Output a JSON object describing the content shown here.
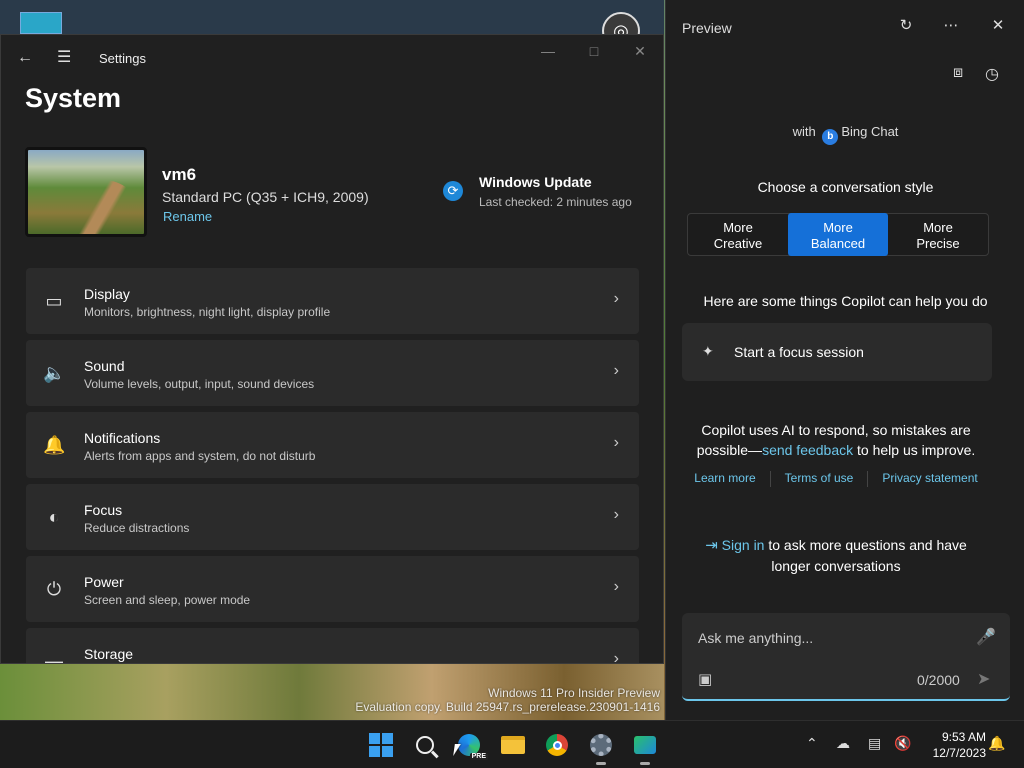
{
  "settings": {
    "window_title": "Settings",
    "page_title": "System",
    "device": {
      "name": "vm6",
      "model": "Standard PC (Q35 + ICH9, 2009)",
      "rename_label": "Rename"
    },
    "windows_update": {
      "title": "Windows Update",
      "status": "Last checked: 2 minutes ago"
    },
    "items": [
      {
        "title": "Display",
        "subtitle": "Monitors, brightness, night light, display profile",
        "icon": "monitor-icon"
      },
      {
        "title": "Sound",
        "subtitle": "Volume levels, output, input, sound devices",
        "icon": "speaker-icon"
      },
      {
        "title": "Notifications",
        "subtitle": "Alerts from apps and system, do not disturb",
        "icon": "bell-icon"
      },
      {
        "title": "Focus",
        "subtitle": "Reduce distractions",
        "icon": "focus-icon"
      },
      {
        "title": "Power",
        "subtitle": "Screen and sleep, power mode",
        "icon": "power-icon"
      },
      {
        "title": "Storage",
        "subtitle": "",
        "icon": "storage-icon"
      }
    ]
  },
  "copilot": {
    "title": "Preview",
    "with_prefix": "with",
    "with_brand": "Bing Chat",
    "style_label": "Choose a conversation style",
    "styles": [
      {
        "line1": "More",
        "line2": "Creative"
      },
      {
        "line1": "More",
        "line2": "Balanced"
      },
      {
        "line1": "More",
        "line2": "Precise"
      }
    ],
    "active_style_index": 1,
    "help_heading": "Here are some things Copilot can help you do",
    "suggestion": "Start a focus session",
    "disclaimer_before": "Copilot uses AI to respond, so mistakes are possible—",
    "disclaimer_link": "send feedback",
    "disclaimer_after": " to help us improve.",
    "links": [
      "Learn more",
      "Terms of use",
      "Privacy statement"
    ],
    "signin_link": "Sign in",
    "signin_rest": " to ask more questions and have longer conversations",
    "input_placeholder": "Ask me anything...",
    "char_count": "0/2000",
    "accent_color": "#1570d8",
    "link_color": "#6cc6ea"
  },
  "desktop": {
    "watermark_line1": "Windows 11 Pro Insider Preview",
    "watermark_line2": "Evaluation copy. Build 25947.rs_prerelease.230901-1416"
  },
  "taskbar": {
    "edge_badge": "PRE",
    "time": "9:53 AM",
    "date": "12/7/2023"
  }
}
